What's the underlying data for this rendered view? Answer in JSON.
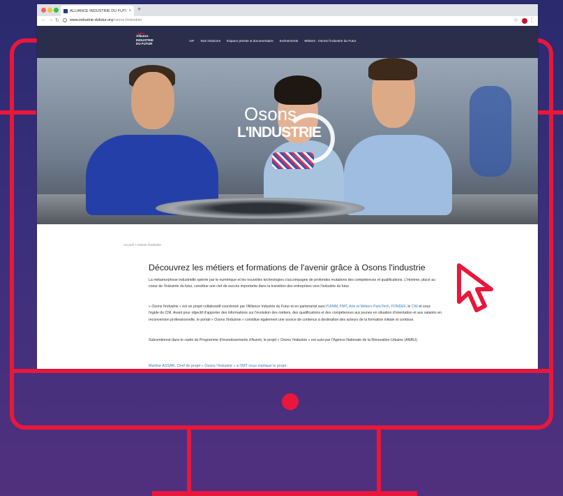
{
  "browser": {
    "tab_title": "ALLIANCE INDUSTRIE DU FUTUR",
    "tab_close": "×",
    "new_tab": "+",
    "url_host": "www.industrie-dufutur.org",
    "url_path": "/osons-lindustrie/",
    "info": "i"
  },
  "site": {
    "logo_lines": [
      "Alliance",
      "INDUSTRIE",
      "DU FUTUR"
    ],
    "nav": [
      "AIF",
      "Nos missions",
      "Espace presse & documentaire",
      "Evènements",
      "Métiers : Osons l'industrie du Futur"
    ]
  },
  "hero": {
    "osons": "Osons",
    "industrie": "L'INDUSTRIE"
  },
  "content": {
    "breadcrumb": "Accueil  >  Osons l'industrie",
    "title": "Découvrez les métiers et formations de l'avenir grâce à Osons l'industrie",
    "p1": "La métamorphose industrielle opérée par le numérique et les nouvelles technologies s'accompagne de profondes mutations des compétences et qualifications. L'Homme, placé au coeur de l'industrie du futur, constitue une clef de succès importante dans la transition des entreprises vers l'industrie du futur.",
    "p2_a": "« Osons l'industrie » est un projet collaboratif coordonné par l'Alliance Industrie du Futur et en partenariat avec l'",
    "p2_link1": "UIMM",
    "p2_b": ", l'",
    "p2_link2": "IMT",
    "p2_c": ", ",
    "p2_link3": "Arts et Métiers ParisTech",
    "p2_d": ", ",
    "p2_link4": "FONDEF",
    "p2_e": ", le ",
    "p2_link5": "CNI",
    "p2_f": " et sous l'égide du CNI. Avant pour objectif d'apporter des informations sur l'évolution des métiers, des qualifications et des compétences aux jeunes en situation d'orientation et aux salariés en reconversion professionnelle, le portail « Osons l'industrie » constitue également une source de contenus à destination des acteurs de la formation initiale et continue.",
    "p3": "Subventionné dans le cadre du Programme d'investissements d'Avenir, le projet « Osons l'industrie » est suivi par l'Agence Nationale de la Rénovation Urbaine (ANRU).",
    "video_caption": "Martine ASSAR, Chef de projet « Osons l'industrie » à l'IMT nous explique le projet :"
  },
  "colors": {
    "accent": "#e8173b",
    "background_top": "#2a2a6e",
    "background_bottom": "#51307e",
    "site_header": "#2b2e4a",
    "link": "#2e7dc0"
  },
  "icons": [
    "cursor-icon",
    "star-icon",
    "menu-icon",
    "reload-icon",
    "back-icon",
    "forward-icon",
    "info-icon"
  ]
}
